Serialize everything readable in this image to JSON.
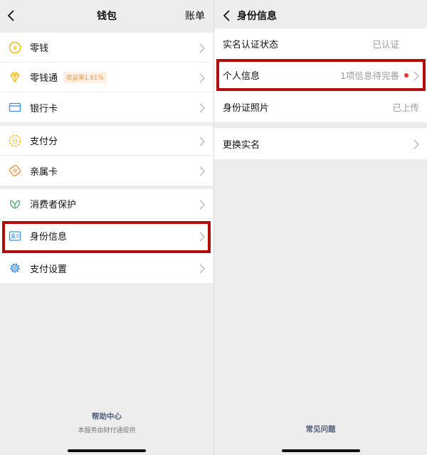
{
  "left": {
    "nav": {
      "title": "钱包",
      "right_label": "账单"
    },
    "groups": [
      {
        "items": [
          {
            "label": "零钱",
            "icon": "coin-icon"
          },
          {
            "label": "零钱通",
            "icon": "diamond-icon",
            "badge": "收益率1.61%"
          },
          {
            "label": "银行卡",
            "icon": "bank-card-icon"
          }
        ]
      },
      {
        "items": [
          {
            "label": "支付分",
            "icon": "pay-score-icon"
          },
          {
            "label": "亲属卡",
            "icon": "family-card-icon"
          }
        ]
      },
      {
        "items": [
          {
            "label": "消费者保护",
            "icon": "leaf-shield-icon"
          },
          {
            "label": "身份信息",
            "icon": "id-card-icon"
          },
          {
            "label": "支付设置",
            "icon": "gear-icon"
          }
        ]
      }
    ],
    "footer": {
      "help_link": "帮助中心",
      "note": "本服务由财付通提供"
    }
  },
  "right": {
    "nav": {
      "title": "身份信息"
    },
    "rows": [
      {
        "label": "实名认证状态",
        "value": "已认证"
      },
      {
        "label": "个人信息",
        "value": "1项信息待完善"
      },
      {
        "label": "身份证照片",
        "value": "已上传"
      },
      {
        "label": "更换实名"
      }
    ],
    "footer": {
      "faq_link": "常见问题"
    }
  },
  "colors": {
    "highlight": "#b30c0c",
    "icon_yellow": "#f5b400",
    "icon_blue": "#3a8ee6",
    "icon_green": "#4caf72",
    "link": "#4f5d7a",
    "red_dot": "#ee3030"
  }
}
